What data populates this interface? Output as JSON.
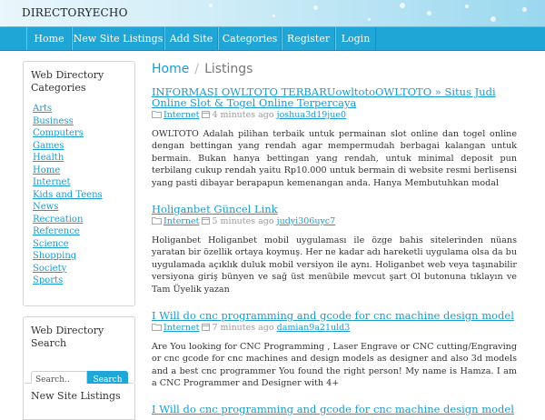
{
  "header": {
    "site_name": "DIRECTORYECHO"
  },
  "nav": {
    "items": [
      {
        "label": "Home"
      },
      {
        "label": "New Site Listings"
      },
      {
        "label": "Add Site"
      },
      {
        "label": "Categories"
      },
      {
        "label": "Register"
      },
      {
        "label": "Login"
      }
    ]
  },
  "sidebar": {
    "categories_title": "Web Directory Categories",
    "categories": [
      "Arts",
      "Business",
      "Computers",
      "Games",
      "Health",
      "Home",
      "Internet",
      "Kids and Teens",
      "News",
      "Recreation",
      "Reference",
      "Science",
      "Shopping",
      "Society",
      "Sports"
    ],
    "search_title": "Web Directory Search",
    "search_placeholder": "Search..",
    "search_button": "Search",
    "new_listings_title": "New Site Listings"
  },
  "breadcrumb": {
    "home": "Home",
    "separator": "/",
    "current": "Listings"
  },
  "listings": [
    {
      "title": "INFORMASI OWLTOTO TERBARUowltotoOWLTOTO » Situs Judi Online Slot & Togel Online Terpercaya",
      "category": "Internet",
      "time": "4 minutes ago",
      "user": "joshua3d19jue0",
      "description": "OWLTOTO Adalah pilihan terbaik untuk permainan slot online dan togel online dengan bettingan yang rendah agar mempermudah berbagai kalangan untuk bermain. Bukan hanya bettingan yang rendah, untuk minimal deposit pun terbilang cukup rendah yaitu Rp10.000 untuk bermain di website resmi berlisensi yang pasti dibayar berapapun kemenangan anda. Hanya Membutuhkan modal"
    },
    {
      "title": "Holiganbet Güncel Link",
      "category": "Internet",
      "time": "5 minutes ago",
      "user": "judyi306uyc7",
      "description": "Holiganbet Holiganbet mobil uygulaması ile özge bahis sitelerinden nüans yaratan bir özellik ortaya koymuş. Her ne kadar adı hareketli uygulama olsa da bu uygulamada açıklık duluk mobil versiyon ile aynı. Holiganbet web veya taşınabilir versiyona giriş bünyen ve sağ üst menübile mevcut şart Ol butonuna tıklayın ve Tam Üyelik yazan"
    },
    {
      "title": "I Will do cnc programming and gcode for cnc machine design model",
      "category": "Internet",
      "time": "7 minutes ago",
      "user": "damian9a21uld3",
      "description": "Are You looking for CNC Programming , Laser Engrave or CNC cutting/Engraving or cnc gcode for cnc machines and design models as designer and also 3d models and a best cnc programmer You found the right person! My name is Hamza. I am a CNC Programmer and Designer with 4+"
    },
    {
      "title": "I Will do cnc programming and gcode for cnc machine design model",
      "category": "",
      "time": "",
      "user": "",
      "description": ""
    }
  ],
  "colors": {
    "accent": "#1fa6d6",
    "link": "#1a9bd1"
  },
  "icons": {
    "category": "folder-icon",
    "time": "calendar-icon"
  }
}
